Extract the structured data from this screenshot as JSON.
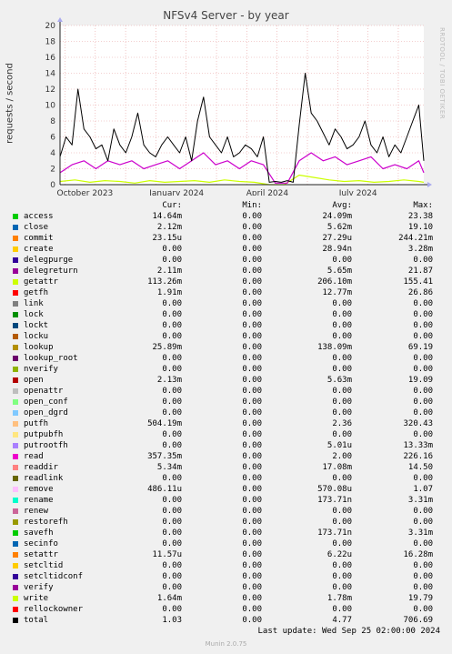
{
  "title": "NFSv4 Server - by year",
  "ylabel": "requests / second",
  "watermark": "RRDTOOL / TOBI OETIKER",
  "chart_data": {
    "type": "line",
    "ylim": [
      0,
      20
    ],
    "yticks": [
      0,
      2,
      4,
      6,
      8,
      10,
      12,
      14,
      16,
      18,
      20
    ],
    "xticks": [
      "October 2023",
      "January 2024",
      "April 2024",
      "July 2024"
    ],
    "grid": true,
    "note": "sampled approximation of dense yearly series (day index 0-365, y in requests/second)",
    "series": [
      {
        "name": "total",
        "color": "#000000",
        "x": [
          0,
          6,
          12,
          18,
          24,
          30,
          36,
          42,
          48,
          54,
          60,
          66,
          72,
          78,
          84,
          90,
          96,
          102,
          108,
          114,
          120,
          126,
          132,
          138,
          144,
          150,
          156,
          162,
          168,
          174,
          180,
          186,
          192,
          198,
          204,
          210,
          216,
          222,
          228,
          234,
          240,
          246,
          252,
          258,
          264,
          270,
          276,
          282,
          288,
          294,
          300,
          306,
          312,
          318,
          324,
          330,
          336,
          342,
          348,
          354,
          360,
          365
        ],
        "y": [
          3.5,
          6,
          5,
          12,
          7,
          6,
          4.5,
          5,
          3,
          7,
          5,
          4,
          6,
          9,
          5,
          4,
          3.5,
          5,
          6,
          5,
          4,
          6,
          3,
          8,
          11,
          6,
          5,
          4,
          6,
          3.5,
          4,
          5,
          4.5,
          3.5,
          6,
          0.3,
          0.4,
          0.3,
          0.5,
          0.3,
          7.5,
          14,
          9,
          8,
          6.5,
          5,
          7,
          6,
          4.5,
          5,
          6,
          8,
          5,
          4,
          6,
          3.5,
          5,
          4,
          6,
          8,
          10,
          3
        ]
      },
      {
        "name": "read",
        "color": "#cc00cc",
        "x": [
          0,
          12,
          24,
          36,
          48,
          60,
          72,
          84,
          96,
          108,
          120,
          132,
          144,
          156,
          168,
          180,
          192,
          204,
          216,
          228,
          240,
          252,
          264,
          276,
          288,
          300,
          312,
          324,
          336,
          348,
          360,
          365
        ],
        "y": [
          1.5,
          2.5,
          3,
          2,
          3,
          2.5,
          3,
          2,
          2.5,
          3,
          2,
          3,
          4,
          2.5,
          3,
          2,
          3,
          2.5,
          0.2,
          0.2,
          3,
          4,
          3,
          3.5,
          2.5,
          3,
          3.5,
          2,
          2.5,
          2,
          3,
          1.5
        ]
      },
      {
        "name": "write",
        "color": "#ccff00",
        "x": [
          0,
          15,
          30,
          45,
          60,
          75,
          90,
          105,
          120,
          135,
          150,
          165,
          180,
          195,
          210,
          225,
          240,
          255,
          270,
          285,
          300,
          315,
          330,
          345,
          360,
          365
        ],
        "y": [
          0.4,
          0.6,
          0.3,
          0.5,
          0.4,
          0.2,
          0.5,
          0.3,
          0.4,
          0.5,
          0.3,
          0.6,
          0.4,
          0.3,
          0.0,
          0.0,
          1.2,
          0.9,
          0.6,
          0.4,
          0.5,
          0.3,
          0.4,
          0.6,
          0.4,
          0.3
        ]
      }
    ]
  },
  "legend": {
    "headers": {
      "cur": "Cur:",
      "min": "Min:",
      "avg": "Avg:",
      "max": "Max:"
    },
    "rows": [
      {
        "name": "access",
        "color": "#00cc00",
        "cur": "14.64m",
        "min": "0.00",
        "avg": "24.09m",
        "max": "23.38"
      },
      {
        "name": "close",
        "color": "#0066b3",
        "cur": "2.12m",
        "min": "0.00",
        "avg": "5.62m",
        "max": "19.10"
      },
      {
        "name": "commit",
        "color": "#ff8000",
        "cur": "23.15u",
        "min": "0.00",
        "avg": "27.29u",
        "max": "244.21m"
      },
      {
        "name": "create",
        "color": "#ffcc00",
        "cur": "0.00",
        "min": "0.00",
        "avg": "28.94n",
        "max": "3.28m"
      },
      {
        "name": "delegpurge",
        "color": "#330099",
        "cur": "0.00",
        "min": "0.00",
        "avg": "0.00",
        "max": "0.00"
      },
      {
        "name": "delegreturn",
        "color": "#990099",
        "cur": "2.11m",
        "min": "0.00",
        "avg": "5.65m",
        "max": "21.87"
      },
      {
        "name": "getattr",
        "color": "#ccff00",
        "cur": "113.26m",
        "min": "0.00",
        "avg": "206.10m",
        "max": "155.41"
      },
      {
        "name": "getfh",
        "color": "#ff0000",
        "cur": "1.91m",
        "min": "0.00",
        "avg": "12.77m",
        "max": "26.86"
      },
      {
        "name": "link",
        "color": "#808080",
        "cur": "0.00",
        "min": "0.00",
        "avg": "0.00",
        "max": "0.00"
      },
      {
        "name": "lock",
        "color": "#008f00",
        "cur": "0.00",
        "min": "0.00",
        "avg": "0.00",
        "max": "0.00"
      },
      {
        "name": "lockt",
        "color": "#00487d",
        "cur": "0.00",
        "min": "0.00",
        "avg": "0.00",
        "max": "0.00"
      },
      {
        "name": "locku",
        "color": "#b35a00",
        "cur": "0.00",
        "min": "0.00",
        "avg": "0.00",
        "max": "0.00"
      },
      {
        "name": "lookup",
        "color": "#b38f00",
        "cur": "25.89m",
        "min": "0.00",
        "avg": "138.09m",
        "max": "69.19"
      },
      {
        "name": "lookup_root",
        "color": "#6b006b",
        "cur": "0.00",
        "min": "0.00",
        "avg": "0.00",
        "max": "0.00"
      },
      {
        "name": "nverify",
        "color": "#8fb300",
        "cur": "0.00",
        "min": "0.00",
        "avg": "0.00",
        "max": "0.00"
      },
      {
        "name": "open",
        "color": "#b30000",
        "cur": "2.13m",
        "min": "0.00",
        "avg": "5.63m",
        "max": "19.09"
      },
      {
        "name": "openattr",
        "color": "#bebebe",
        "cur": "0.00",
        "min": "0.00",
        "avg": "0.00",
        "max": "0.00"
      },
      {
        "name": "open_conf",
        "color": "#80ff80",
        "cur": "0.00",
        "min": "0.00",
        "avg": "0.00",
        "max": "0.00"
      },
      {
        "name": "open_dgrd",
        "color": "#80c9ff",
        "cur": "0.00",
        "min": "0.00",
        "avg": "0.00",
        "max": "0.00"
      },
      {
        "name": "putfh",
        "color": "#ffc080",
        "cur": "504.19m",
        "min": "0.00",
        "avg": "2.36",
        "max": "320.43"
      },
      {
        "name": "putpubfh",
        "color": "#ffe680",
        "cur": "0.00",
        "min": "0.00",
        "avg": "0.00",
        "max": "0.00"
      },
      {
        "name": "putrootfh",
        "color": "#aa80ff",
        "cur": "0.00",
        "min": "0.00",
        "avg": "5.01u",
        "max": "13.33m"
      },
      {
        "name": "read",
        "color": "#ee00cc",
        "cur": "357.35m",
        "min": "0.00",
        "avg": "2.00",
        "max": "226.16"
      },
      {
        "name": "readdir",
        "color": "#ff8080",
        "cur": "5.34m",
        "min": "0.00",
        "avg": "17.08m",
        "max": "14.50"
      },
      {
        "name": "readlink",
        "color": "#666600",
        "cur": "0.00",
        "min": "0.00",
        "avg": "0.00",
        "max": "0.00"
      },
      {
        "name": "remove",
        "color": "#ffbfff",
        "cur": "486.11u",
        "min": "0.00",
        "avg": "570.08u",
        "max": "1.07"
      },
      {
        "name": "rename",
        "color": "#00ffcc",
        "cur": "0.00",
        "min": "0.00",
        "avg": "173.71n",
        "max": "3.31m"
      },
      {
        "name": "renew",
        "color": "#cc6699",
        "cur": "0.00",
        "min": "0.00",
        "avg": "0.00",
        "max": "0.00"
      },
      {
        "name": "restorefh",
        "color": "#999900",
        "cur": "0.00",
        "min": "0.00",
        "avg": "0.00",
        "max": "0.00"
      },
      {
        "name": "savefh",
        "color": "#00cc00",
        "cur": "0.00",
        "min": "0.00",
        "avg": "173.71n",
        "max": "3.31m"
      },
      {
        "name": "secinfo",
        "color": "#0066b3",
        "cur": "0.00",
        "min": "0.00",
        "avg": "0.00",
        "max": "0.00"
      },
      {
        "name": "setattr",
        "color": "#ff8000",
        "cur": "11.57u",
        "min": "0.00",
        "avg": "6.22u",
        "max": "16.28m"
      },
      {
        "name": "setcltid",
        "color": "#ffcc00",
        "cur": "0.00",
        "min": "0.00",
        "avg": "0.00",
        "max": "0.00"
      },
      {
        "name": "setcltidconf",
        "color": "#330099",
        "cur": "0.00",
        "min": "0.00",
        "avg": "0.00",
        "max": "0.00"
      },
      {
        "name": "verify",
        "color": "#990099",
        "cur": "0.00",
        "min": "0.00",
        "avg": "0.00",
        "max": "0.00"
      },
      {
        "name": "write",
        "color": "#ccff00",
        "cur": "1.64m",
        "min": "0.00",
        "avg": "1.78m",
        "max": "19.79"
      },
      {
        "name": "rellockowner",
        "color": "#ff0000",
        "cur": "0.00",
        "min": "0.00",
        "avg": "0.00",
        "max": "0.00"
      },
      {
        "name": "total",
        "color": "#000000",
        "cur": "1.03",
        "min": "0.00",
        "avg": "4.77",
        "max": "706.69"
      }
    ]
  },
  "last_update": "Last update: Wed Sep 25 02:00:00 2024",
  "munin_version": "Munin 2.0.75"
}
